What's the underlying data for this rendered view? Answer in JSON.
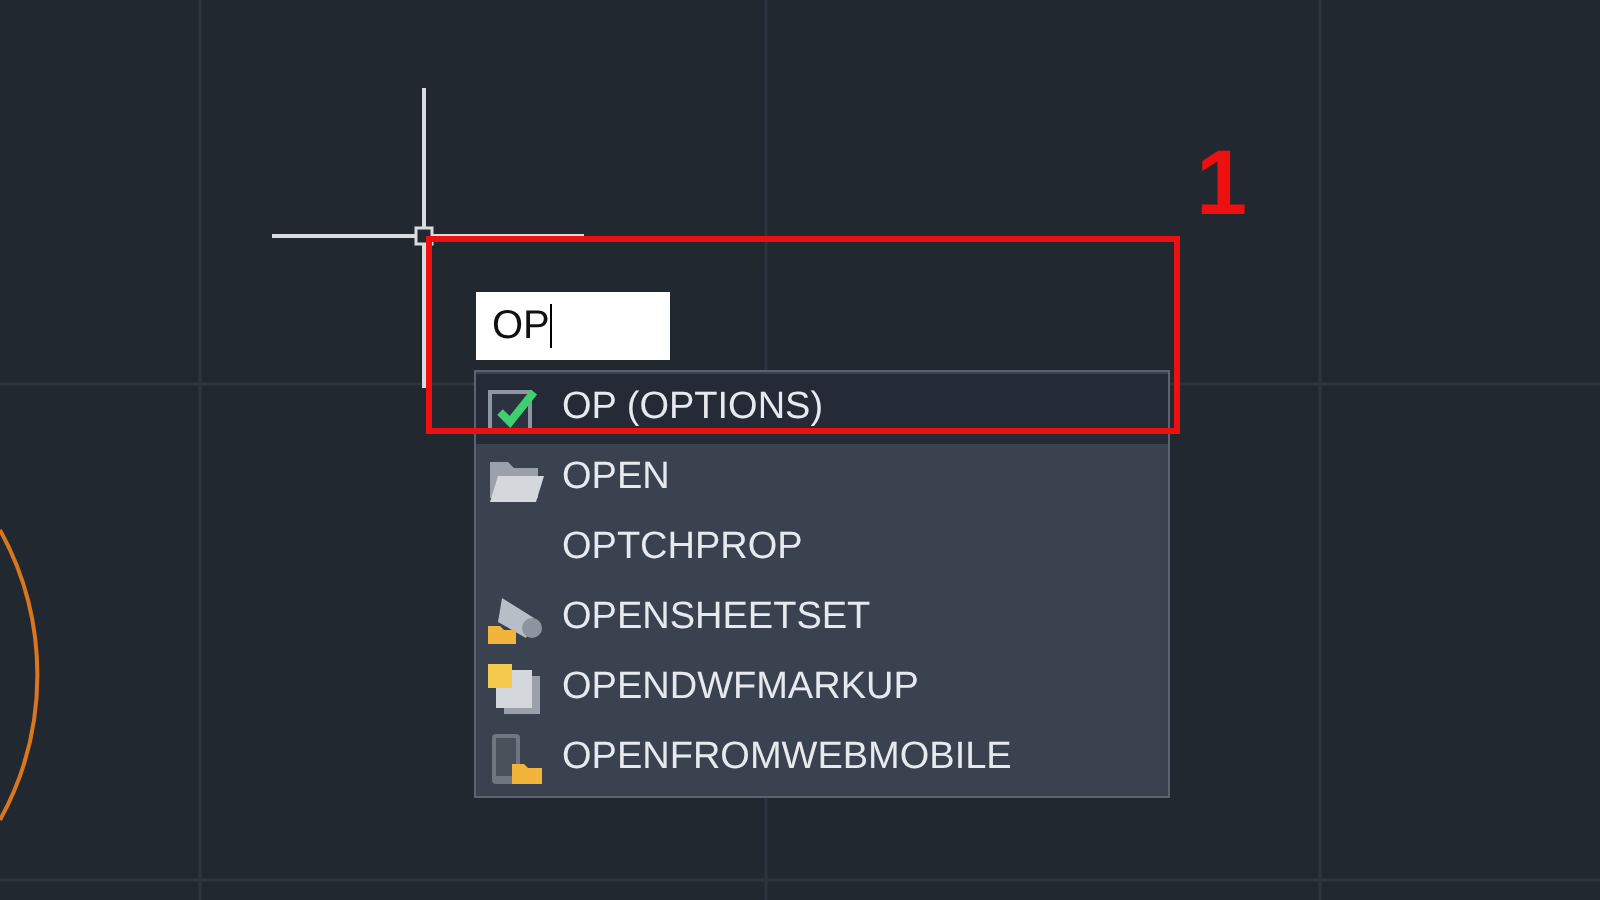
{
  "command_input": {
    "value": "OP"
  },
  "suggestions": [
    {
      "label": "OP (OPTIONS)",
      "kind": "check",
      "selected": true
    },
    {
      "label": "OPEN",
      "kind": "folder",
      "selected": false
    },
    {
      "label": "OPTCHPROP",
      "kind": "none",
      "selected": false
    },
    {
      "label": "OPENSHEETSET",
      "kind": "sheetset",
      "selected": false
    },
    {
      "label": "OPENDWFMARKUP",
      "kind": "markup",
      "selected": false
    },
    {
      "label": "OPENFROMWEBMOBILE",
      "kind": "mobile",
      "selected": false
    }
  ],
  "annotation": {
    "number": "1"
  }
}
